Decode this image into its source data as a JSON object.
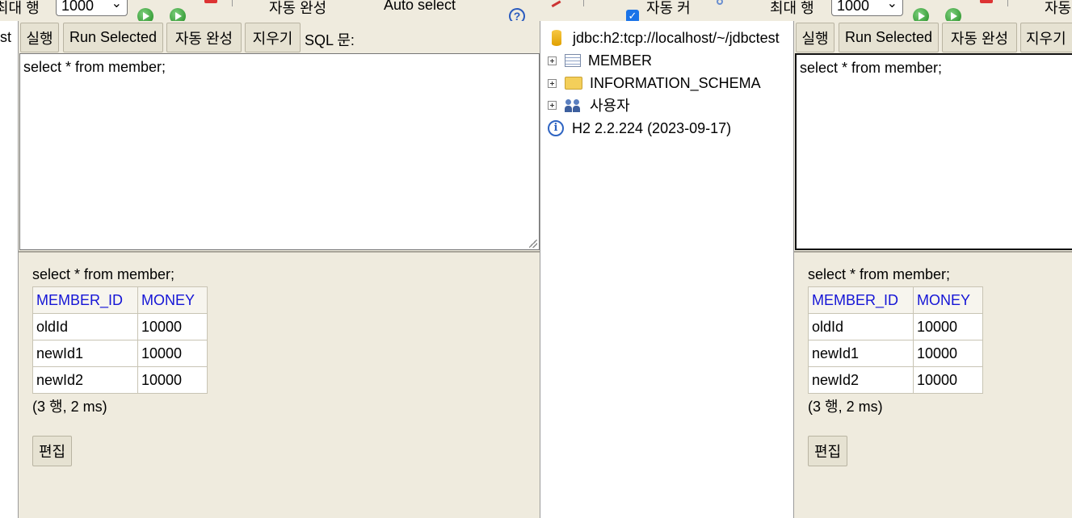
{
  "toolbar": {
    "max_rows_label_left": "최대 행",
    "max_rows_value_left": "1000",
    "autocomplete_label_left": "자동 완성",
    "auto_select_label": "Auto select",
    "help_icon": "?",
    "auto_commit_label": "자동 커",
    "max_rows_label_right": "최대 행",
    "max_rows_value_right": "1000",
    "autocomplete_label_right": "자동",
    "chevron": "⌄"
  },
  "left_panel": {
    "tab_fragment": "st",
    "buttons": {
      "run": "실행",
      "run_selected": "Run Selected",
      "autocomplete": "자동 완성",
      "clear": "지우기"
    },
    "sql_label": "SQL 문:",
    "sql_text": "select * from member;",
    "result": {
      "query": "select * from member;",
      "columns": [
        "MEMBER_ID",
        "MONEY"
      ],
      "rows": [
        [
          "oldId",
          "10000"
        ],
        [
          "newId1",
          "10000"
        ],
        [
          "newId2",
          "10000"
        ]
      ],
      "summary": "(3 행, 2 ms)",
      "edit_label": "편집"
    }
  },
  "tree": {
    "connection": "jdbc:h2:tcp://localhost/~/jdbctest",
    "items": [
      {
        "label": "MEMBER",
        "icon": "table-icon"
      },
      {
        "label": "INFORMATION_SCHEMA",
        "icon": "folder-icon"
      },
      {
        "label": "사용자",
        "icon": "users-icon"
      }
    ],
    "version": "H2 2.2.224 (2023-09-17)"
  },
  "right_panel": {
    "buttons": {
      "run": "실행",
      "run_selected": "Run Selected",
      "autocomplete": "자동 완성",
      "clear": "지우기"
    },
    "sql_text": "select * from member;",
    "result": {
      "query": "select * from member;",
      "columns": [
        "MEMBER_ID",
        "MONEY"
      ],
      "rows": [
        [
          "oldId",
          "10000"
        ],
        [
          "newId1",
          "10000"
        ],
        [
          "newId2",
          "10000"
        ]
      ],
      "summary": "(3 행, 2 ms)",
      "edit_label": "편집"
    }
  },
  "colors": {
    "panel": "#efebde",
    "header_link": "#1515d6",
    "run_green": "#1c8a1c"
  }
}
